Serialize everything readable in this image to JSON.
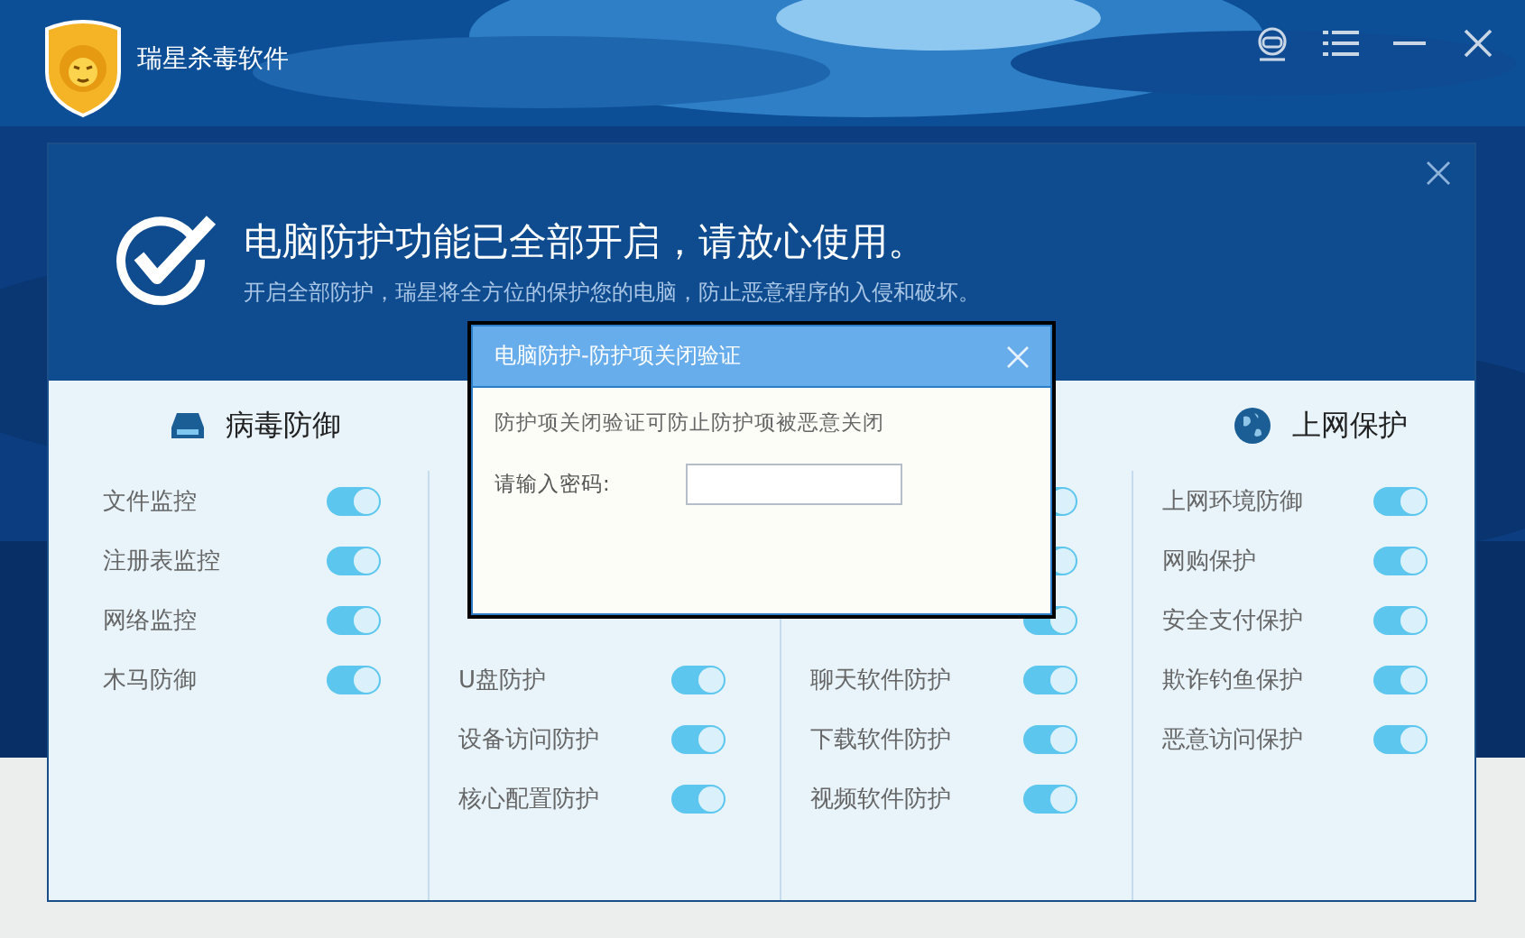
{
  "window": {
    "title": "瑞星杀毒软件"
  },
  "banner": {
    "title": "电脑防护功能已全部开启，请放心使用。",
    "subtitle": "开启全部防护，瑞星将全方位的保护您的电脑，防止恶意程序的入侵和破坏。"
  },
  "columns": [
    {
      "heading": "病毒防御",
      "items": [
        {
          "kind": "toggle",
          "label": "文件监控",
          "on": true
        },
        {
          "kind": "toggle",
          "label": "注册表监控",
          "on": true
        },
        {
          "kind": "toggle",
          "label": "网络监控",
          "on": true
        },
        {
          "kind": "toggle",
          "label": "木马防御",
          "on": true
        }
      ]
    },
    {
      "items": [
        {
          "kind": "covered"
        },
        {
          "kind": "covered"
        },
        {
          "kind": "covered"
        },
        {
          "kind": "toggle",
          "label": "U盘防护",
          "on": true
        },
        {
          "kind": "toggle",
          "label": "设备访问防护",
          "on": true
        },
        {
          "kind": "toggle",
          "label": "核心配置防护",
          "on": true
        }
      ]
    },
    {
      "items": [
        {
          "kind": "toggle_only",
          "on": true
        },
        {
          "kind": "toggle_only",
          "on": true
        },
        {
          "kind": "toggle_only",
          "on": true
        },
        {
          "kind": "toggle",
          "label": "聊天软件防护",
          "on": true
        },
        {
          "kind": "toggle",
          "label": "下载软件防护",
          "on": true
        },
        {
          "kind": "toggle",
          "label": "视频软件防护",
          "on": true
        }
      ]
    },
    {
      "heading": "上网保护",
      "items": [
        {
          "kind": "toggle",
          "label": "上网环境防御",
          "on": true
        },
        {
          "kind": "toggle",
          "label": "网购保护",
          "on": true
        },
        {
          "kind": "toggle",
          "label": "安全支付保护",
          "on": true
        },
        {
          "kind": "toggle",
          "label": "欺诈钓鱼保护",
          "on": true
        },
        {
          "kind": "toggle",
          "label": "恶意访问保护",
          "on": true
        }
      ]
    }
  ],
  "dialog": {
    "title": "电脑防护-防护项关闭验证",
    "message": "防护项关闭验证可防止防护项被恶意关闭",
    "password_label": "请输入密码:"
  }
}
